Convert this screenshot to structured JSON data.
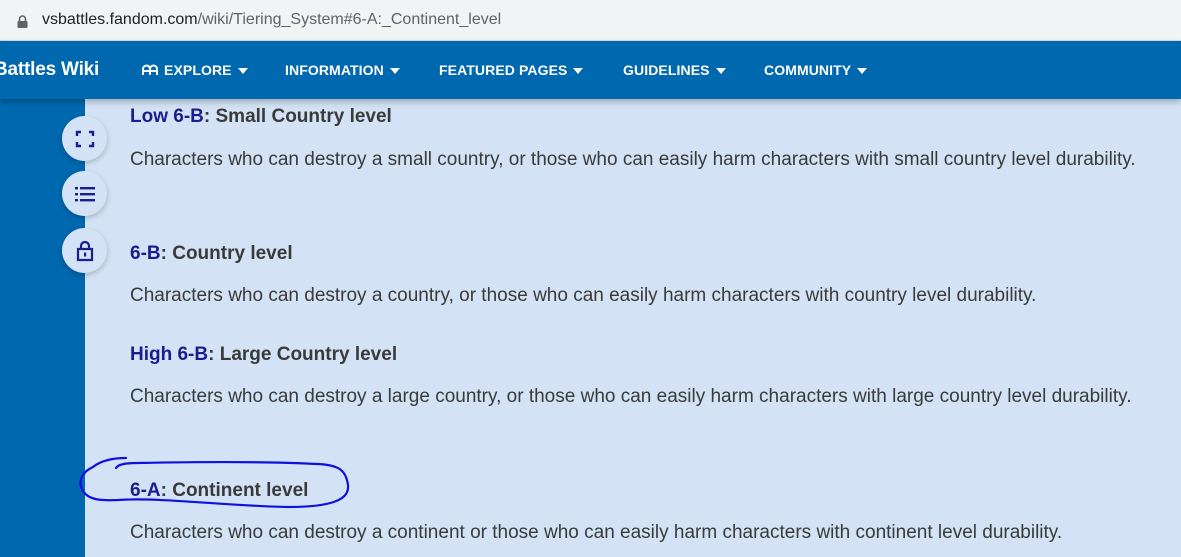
{
  "browser": {
    "url_host": "vsbattles.fandom.com",
    "url_path": "/wiki/Tiering_System#6-A:_Continent_level"
  },
  "nav": {
    "wiki_name": "Battles Wiki",
    "items": [
      {
        "label": "EXPLORE",
        "icon": "explore-icon"
      },
      {
        "label": "INFORMATION"
      },
      {
        "label": "FEATURED PAGES"
      },
      {
        "label": "GUIDELINES"
      },
      {
        "label": "COMMUNITY"
      }
    ]
  },
  "rail": {
    "buttons": [
      {
        "icon": "expand-icon"
      },
      {
        "icon": "table-of-contents-icon"
      },
      {
        "icon": "lock-icon"
      }
    ]
  },
  "sections": [
    {
      "tier": "Low 6-B",
      "title": ": Small Country level",
      "text": "Characters who can destroy a small country, or those who can easily harm characters with small country level durability."
    },
    {
      "tier": "6-B",
      "title": ": Country level",
      "text": "Characters who can destroy a country, or those who can easily harm characters with country level durability."
    },
    {
      "tier": "High 6-B",
      "title": ": Large Country level",
      "text": "Characters who can destroy a large country, or those who can easily harm characters with large country level durability."
    },
    {
      "tier": "6-A",
      "title": ": Continent level",
      "text": "Characters who can destroy a continent or those who can easily harm characters with continent level durability."
    }
  ],
  "colors": {
    "brand_blue": "#0068ae",
    "content_bg": "#d3e3f5",
    "tier_link": "#1c1c8c",
    "annotation_ink": "#1010e0"
  }
}
